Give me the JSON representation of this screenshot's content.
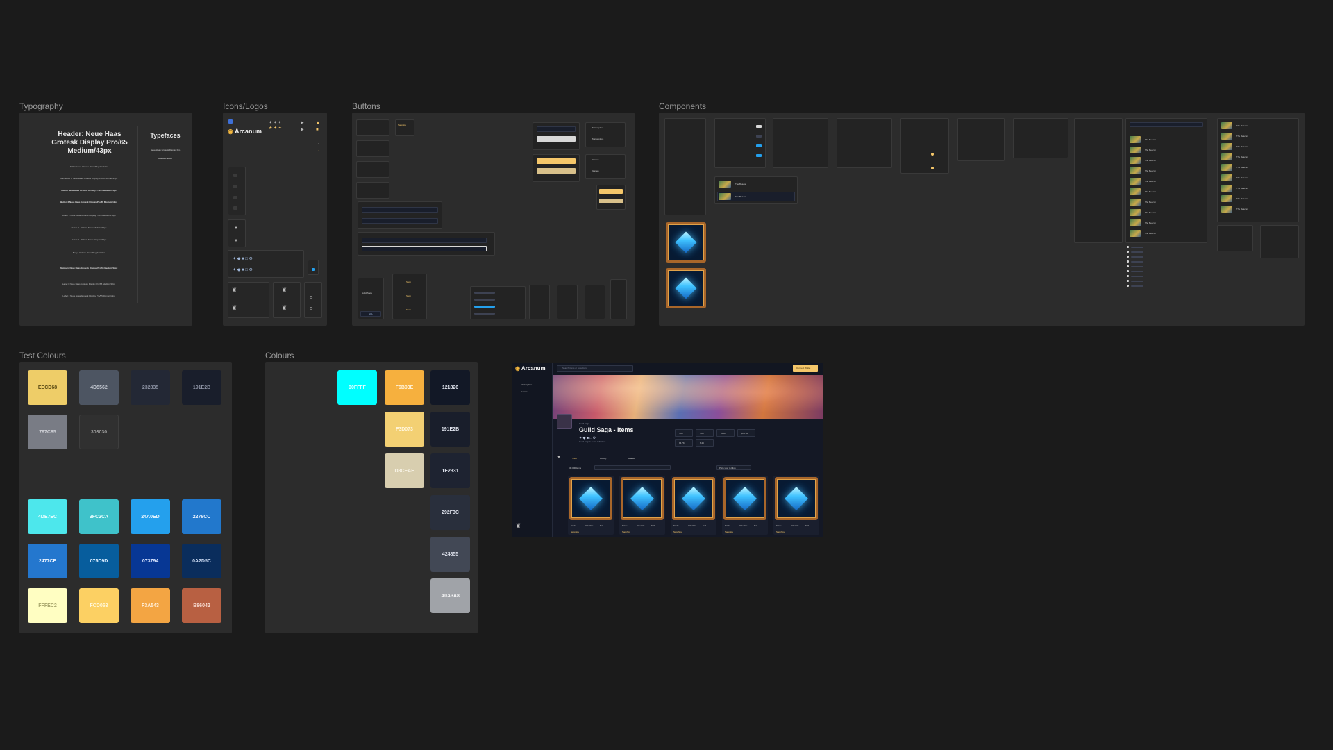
{
  "sections": {
    "typography": "Typography",
    "icons": "Icons/Logos",
    "buttons": "Buttons",
    "components": "Components",
    "test_colours": "Test Colours",
    "colours": "Colours"
  },
  "typography": {
    "header": "Header: Neue Haas Grotesk Display Pro/65 Medium/43px",
    "typefaces_title": "Typefaces",
    "typeface_1": "Neue Haas Grotesk Display Pro",
    "typeface_2": "Roboto Mono",
    "lines": [
      {
        "text": "Subheader - Roboto Mono/Regular/14px",
        "bold": false
      },
      {
        "text": "Subheader 2 Neue Haas Grotesk Display Pro/55 Roman/14px",
        "bold": false
      },
      {
        "text": "Button Neue Haas Grotesk Display Pro/65 Medium/14px",
        "bold": true
      },
      {
        "text": "Button 2 Neue Haas Grotesk Display Pro/65 Medium/12px",
        "bold": true
      },
      {
        "text": "Button 3 Neue Haas Grotesk Display Pro/65 Medium/10px",
        "bold": false
      },
      {
        "text": "Button 4 - Roboto Mono/Medium/10px",
        "bold": false
      },
      {
        "text": "Button 5 - Roboto Mono/Regular/10px",
        "bold": false
      },
      {
        "text": "Body - Roboto Mono/Regular/10px",
        "bold": false
      },
      {
        "text": "Numbers Neue Haas Grotesk Display Pro/65 Medium/12px",
        "bold": true
      },
      {
        "text": "Label 1 Neue Haas Grotesk Display Pro/65 Medium/10px",
        "bold": false
      },
      {
        "text": "Label 2 Neue Haas Grotesk Display Pro/55 Roman/10px",
        "bold": false
      }
    ]
  },
  "logo": {
    "text": "Arcanum"
  },
  "buttons": {
    "tiny_labels": {
      "view_guild": "View Guild Website",
      "marketplace": "Marketplace",
      "games": "Games",
      "buy_now": "Buy Now",
      "connect": "Connect Wallet",
      "shop": "Shop",
      "guild_saga": "Guild Saga",
      "sol": "SOL",
      "search": "Search items or collections"
    }
  },
  "components": {
    "list_item": "The Beacon",
    "sort_options": [
      "Price Low to High",
      "Price High to Low",
      "Latest"
    ]
  },
  "test_colours": [
    {
      "hex": "EECD68",
      "color": "#eecd68",
      "text": "#5a4a14"
    },
    {
      "hex": "4D5562",
      "color": "#4d5562",
      "text": "#c2c7d0"
    },
    {
      "hex": "232835",
      "color": "#232835",
      "text": "#8c92a3"
    },
    {
      "hex": "191E2B",
      "color": "#191e2b",
      "text": "#8c92a3"
    },
    {
      "hex": "797C85",
      "color": "#797c85",
      "text": "#d2d4da"
    },
    {
      "hex": "303030",
      "color": "#303030",
      "text": "#9a9a9a"
    },
    {
      "hex": "4DE7EC",
      "color": "#4de7ec",
      "text": "#e9ffff"
    },
    {
      "hex": "3FC2CA",
      "color": "#3fc2ca",
      "text": "#e9ffff"
    },
    {
      "hex": "24A0ED",
      "color": "#24a0ed",
      "text": "#e9f6ff"
    },
    {
      "hex": "2278CC",
      "color": "#2278cc",
      "text": "#e9f2ff"
    },
    {
      "hex": "2477CE",
      "color": "#2477ce",
      "text": "#e9f2ff"
    },
    {
      "hex": "075D9D",
      "color": "#075d9d",
      "text": "#d8ecff"
    },
    {
      "hex": "073794",
      "color": "#073794",
      "text": "#d8e4ff"
    },
    {
      "hex": "0A2D5C",
      "color": "#0a2d5c",
      "text": "#c8d8f0"
    },
    {
      "hex": "FFFEC2",
      "color": "#fffec2",
      "text": "#a6a46a"
    },
    {
      "hex": "FCD063",
      "color": "#fcd063",
      "text": "#fff7d8"
    },
    {
      "hex": "F3A543",
      "color": "#f3a543",
      "text": "#fff0dc"
    },
    {
      "hex": "B86042",
      "color": "#b86042",
      "text": "#f7dcd2"
    }
  ],
  "colours": [
    {
      "hex": "00FFFF",
      "color": "#00ffff",
      "text": "#eaffff"
    },
    {
      "hex": "F6B03E",
      "color": "#f6b03e",
      "text": "#fff3da"
    },
    {
      "hex": "121826",
      "color": "#121826",
      "text": "#e0e4ee"
    },
    {
      "hex": "F3D073",
      "color": "#f3d073",
      "text": "#fff6dc"
    },
    {
      "hex": "191E2B",
      "color": "#191e2b",
      "text": "#e0e4ee"
    },
    {
      "hex": "D8CEAF",
      "color": "#d8ceaf",
      "text": "#f7f3e6"
    },
    {
      "hex": "1E2331",
      "color": "#1e2331",
      "text": "#e0e4ee"
    },
    {
      "hex": "292F3C",
      "color": "#292f3c",
      "text": "#e0e4ee"
    },
    {
      "hex": "424855",
      "color": "#424855",
      "text": "#e0e4ee"
    },
    {
      "hex": "A0A3A8",
      "color": "#a0a3a8",
      "text": "#f4f4f5"
    }
  ],
  "marketplace": {
    "logo": "Arcanum",
    "search_placeholder": "Search items or collections",
    "connect_button": "Connect Wallet",
    "nav": [
      "Marketplace",
      "Games"
    ],
    "collection_tag": "Guild Saga",
    "collection_title": "Guild Saga - Items",
    "collection_sub": "Guild Saga's items collection",
    "stats": [
      "SOL",
      "SOL",
      "1000",
      "$78.85",
      "94.7K",
      "6.2K"
    ],
    "tabs": [
      "Shop",
      "Activity",
      "Related"
    ],
    "filter_label": "30,000 items",
    "sort_label": "Price Low to High",
    "items": [
      {
        "tag": "Sapphire"
      },
      {
        "tag": "Sapphire"
      },
      {
        "tag": "Sapphire"
      },
      {
        "tag": "Sapphire"
      },
      {
        "tag": "Sapphire"
      }
    ],
    "item_buttons": [
      "Trade",
      "Valuable",
      "Sell"
    ]
  }
}
